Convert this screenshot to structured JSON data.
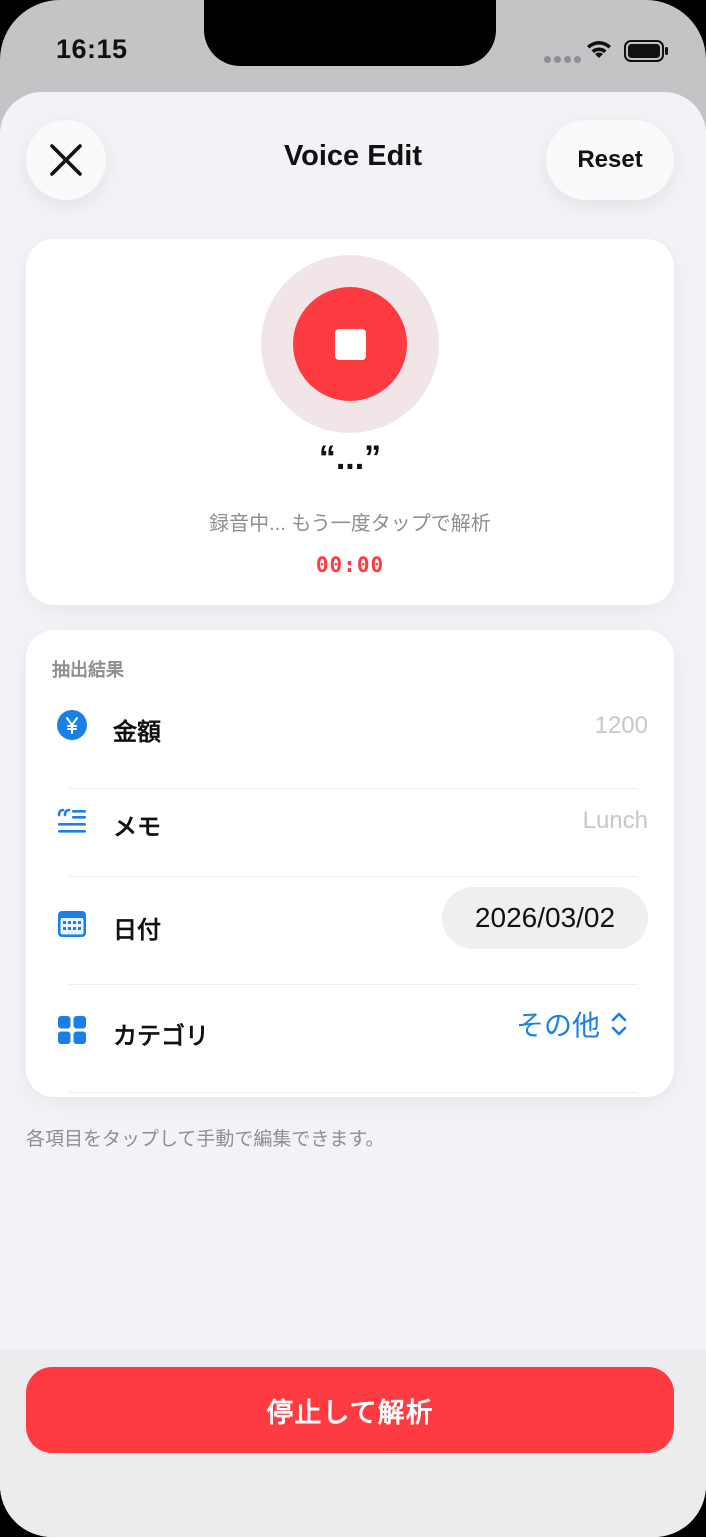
{
  "status_bar": {
    "time": "16:15",
    "icons": [
      "signal-dots-icon",
      "wifi-icon",
      "battery-icon"
    ]
  },
  "header": {
    "title": "Voice Edit",
    "close_icon": "close-icon",
    "reset_label": "Reset"
  },
  "recorder": {
    "transcript": "“...”",
    "hint": "録音中... もう一度タップで解析",
    "timer": "00:00",
    "state_icon": "stop-icon"
  },
  "results": {
    "section_title": "抽出結果",
    "rows": [
      {
        "icon": "yen-circle-icon",
        "label": "金額",
        "value": "1200"
      },
      {
        "icon": "memo-quote-icon",
        "label": "メモ",
        "value": "Lunch"
      },
      {
        "icon": "calendar-icon",
        "label": "日付",
        "value": "2026/03/02"
      },
      {
        "icon": "category-grid-icon",
        "label": "カテゴリ",
        "value": "その他"
      }
    ]
  },
  "footnote": "各項目をタップして手動で編集できます。",
  "primary_action": {
    "label": "停止して解析"
  },
  "colors": {
    "accent_red": "#fe3b41",
    "accent_blue": "#1a7fe6",
    "background": "#f2f2f7",
    "muted_text": "#8e8e93"
  }
}
